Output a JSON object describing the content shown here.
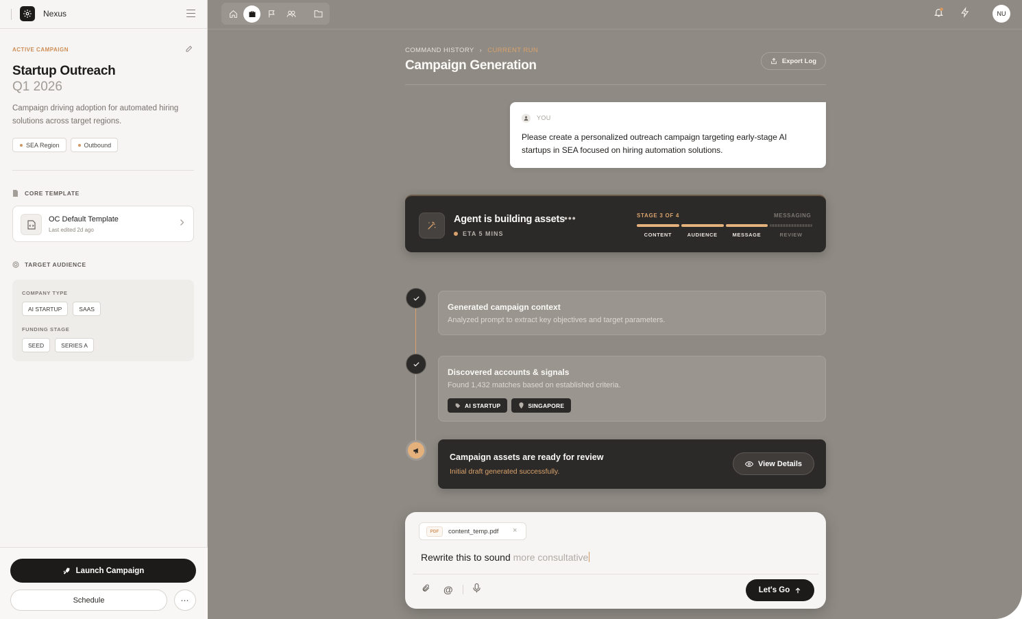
{
  "app": {
    "name": "Nexus",
    "logo_icon": "gear-icon",
    "accent": "#d29662",
    "dark": "#1c1b1a"
  },
  "sidebar": {
    "active_label": "ACTIVE CAMPAIGN",
    "campaign_title": "Startup Outreach",
    "campaign_period": "Q1 2026",
    "description": "Campaign driving adoption for automated hiring solutions across target regions.",
    "tags": [
      "SEA Region",
      "Outbound"
    ],
    "core_template": {
      "heading": "CORE TEMPLATE",
      "name": "OC Default Template",
      "meta": "Last edited 2d ago"
    },
    "target_audience": {
      "heading": "TARGET AUDIENCE",
      "company_type_label": "COMPANY TYPE",
      "company_types": [
        "AI STARTUP",
        "SAAS"
      ],
      "funding_stage_label": "FUNDING STAGE",
      "funding_stages": [
        "SEED",
        "SERIES A"
      ]
    },
    "launch_label": "Launch Campaign",
    "schedule_label": "Schedule",
    "more_label": "⋯"
  },
  "topbar": {
    "nav_icons": [
      "home-icon",
      "briefcase-icon",
      "flag-icon",
      "users-icon",
      "folder-icon"
    ],
    "active_nav": "briefcase-icon",
    "avatar_initials": "NU"
  },
  "main": {
    "breadcrumb": {
      "parent": "COMMAND HISTORY",
      "current": "CURRENT RUN"
    },
    "title": "Campaign Generation",
    "export_label": "Export Log",
    "user_message": {
      "label": "YOU",
      "text": "Please create a personalized outreach campaign targeting early-stage AI startups in SEA focused on hiring automation solutions."
    },
    "agent": {
      "title": "Agent is building assets",
      "eta": "ETA 5 MINS",
      "stage_label": "STAGE 3 OF 4",
      "stage_current": "MESSAGING",
      "stages": [
        "CONTENT",
        "AUDIENCE",
        "MESSAGE",
        "REVIEW"
      ],
      "stages_completed": 3
    },
    "steps": [
      {
        "title": "Generated campaign context",
        "desc": "Analyzed prompt to extract key objectives and target parameters."
      },
      {
        "title": "Discovered accounts & signals",
        "desc": "Found 1,432 matches based on established criteria.",
        "tags": [
          "AI STARTUP",
          "SINGAPORE"
        ]
      }
    ],
    "ready": {
      "title": "Campaign assets are ready for review",
      "subtitle": "Initial draft generated successfully.",
      "button": "View Details"
    },
    "composer": {
      "attachment_type": "PDF",
      "attachment_name": "content_temp.pdf",
      "typed_text": "Rewrite this to sound ",
      "suggestion": "more consultative",
      "submit_label": "Let's Go"
    }
  }
}
